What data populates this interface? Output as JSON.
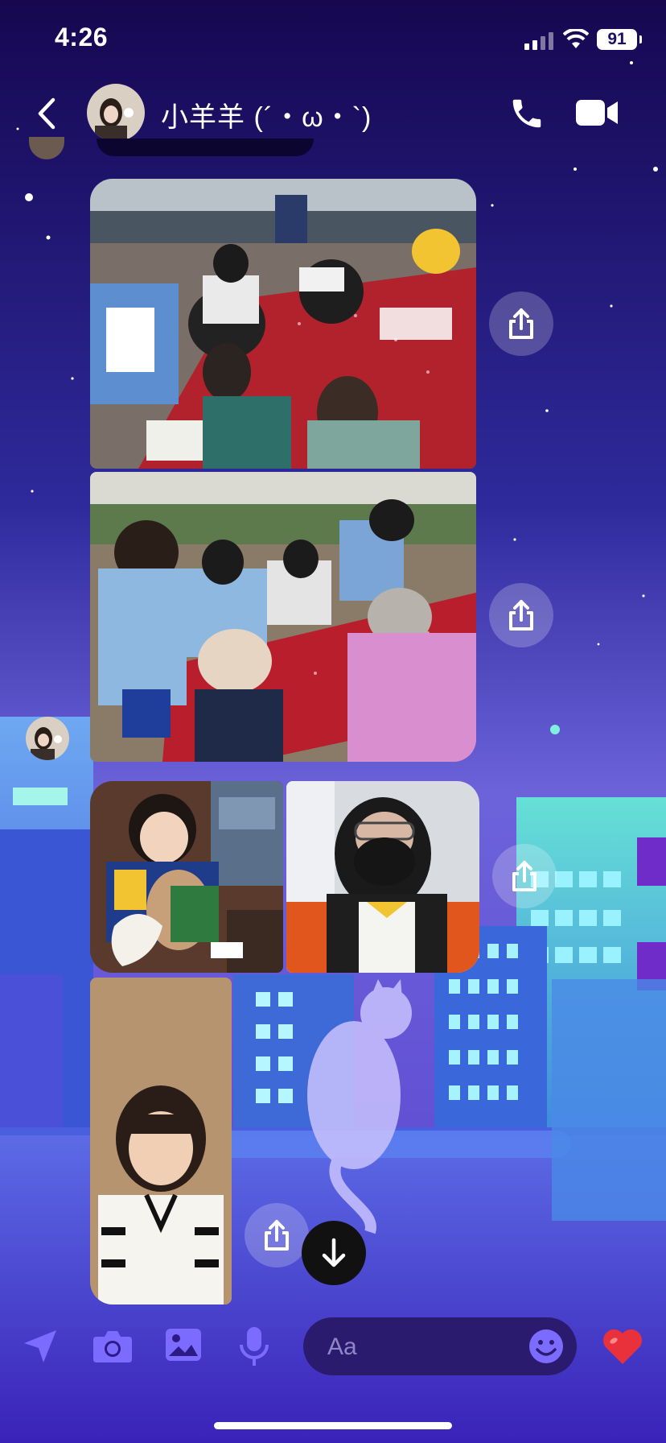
{
  "status_bar": {
    "time": "4:26",
    "battery": "91"
  },
  "header": {
    "contact_name": "小羊羊 (´・ω・`)"
  },
  "composer": {
    "placeholder": "Aa"
  },
  "theme": {
    "accent": "#7b6cff",
    "bg_top": "#1b0a58",
    "bg_bottom": "#3a1fb0",
    "heart": "#e8313a"
  },
  "icons": [
    "back-chevron",
    "phone",
    "video-camera",
    "share",
    "arrow-down",
    "location-arrow",
    "camera",
    "image",
    "microphone",
    "emoji",
    "heart"
  ]
}
